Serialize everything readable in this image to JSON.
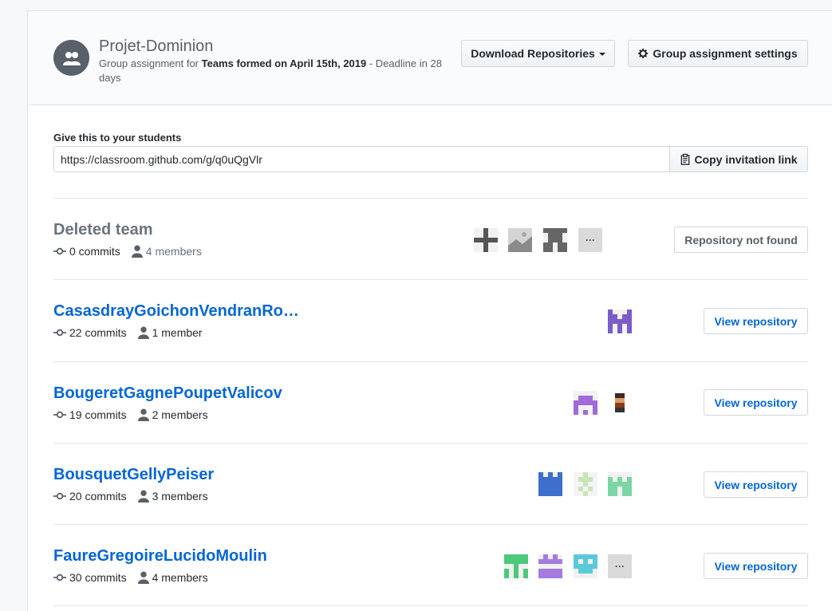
{
  "assignment": {
    "title": "Projet-Dominion",
    "subtitle_prefix": "Group assignment for ",
    "team_set": "Teams formed on April 15th, 2019",
    "subtitle_suffix": " - Deadline in 28 days"
  },
  "toolbar": {
    "download_label": "Download Repositories",
    "settings_label": "Group assignment settings"
  },
  "invite": {
    "label": "Give this to your students",
    "url": "https://classroom.github.com/g/q0uQgVlr",
    "copy_label": "Copy invitation link"
  },
  "teams": [
    {
      "name": "Deleted team",
      "commits": "0 commits",
      "members": "4 members",
      "action": "Repository not found"
    },
    {
      "name": "CasasdrayGoichonVendranRo…",
      "commits": "22 commits",
      "members": "1 member",
      "action": "View repository"
    },
    {
      "name": "BougeretGagnePoupetValicov",
      "commits": "19 commits",
      "members": "2 members",
      "action": "View repository"
    },
    {
      "name": "BousquetGellyPeiser",
      "commits": "20 commits",
      "members": "3 members",
      "action": "View repository"
    },
    {
      "name": "FaureGregoireLucidoMoulin",
      "commits": "30 commits",
      "members": "4 members",
      "action": "View repository"
    }
  ],
  "more_label": "···",
  "colors": {
    "link": "#0366d6",
    "muted": "#6a737d",
    "border": "#e1e4e8"
  }
}
